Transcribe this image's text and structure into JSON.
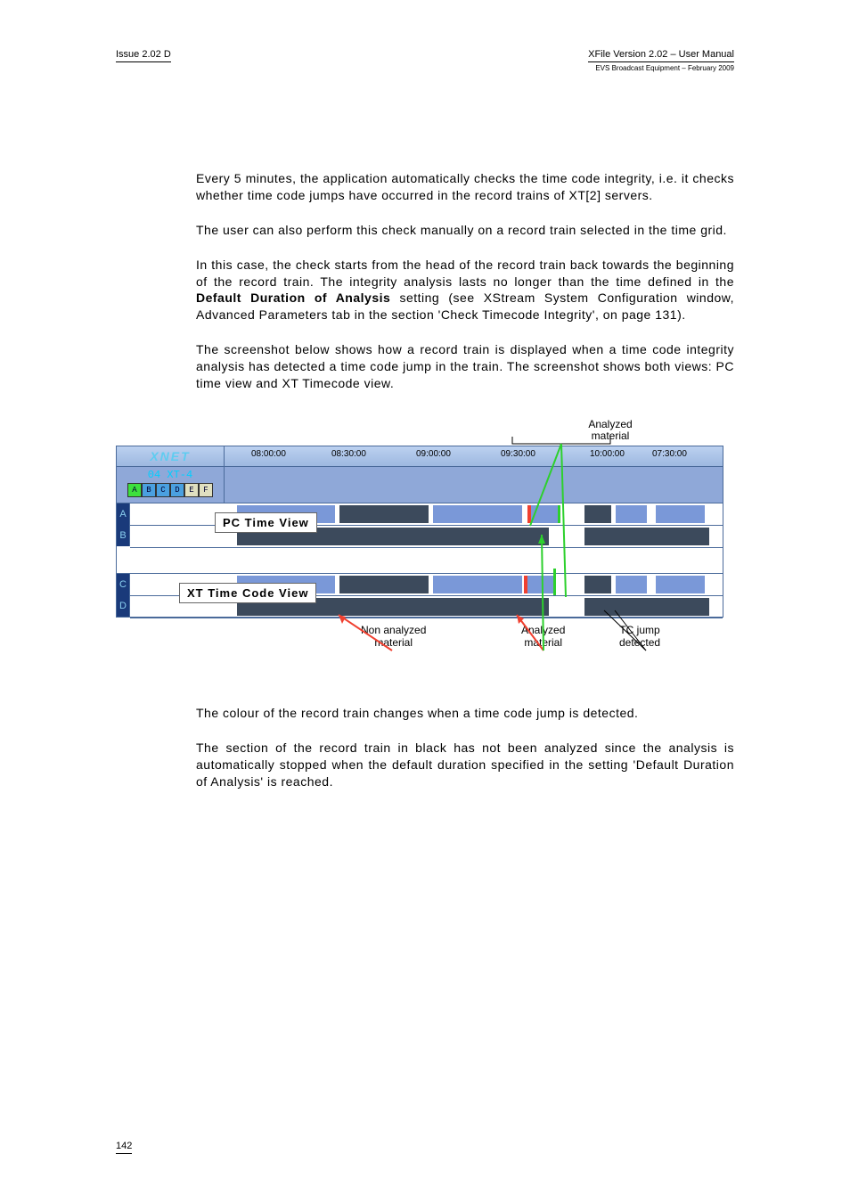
{
  "header": {
    "left": "Issue 2.02 D",
    "right_line1": "XFile Version 2.02 – User Manual",
    "right_line2": "EVS Broadcast Equipment – February 2009"
  },
  "paragraphs": {
    "p1": "Every 5 minutes, the application automatically checks the time code integrity, i.e. it checks whether time code jumps have occurred in the record trains of XT[2] servers.",
    "p2": "The user can also perform this check manually on a record train selected in the time grid.",
    "p3a": "In this case, the check starts from the head of the record train back towards the beginning of the record train. The integrity analysis lasts no longer than the time defined in the ",
    "p3b": "Default Duration of Analysis",
    "p3c": " setting (see XStream System Configuration window, Advanced Parameters tab in the section 'Check Timecode Integrity', on page 131).",
    "p4": "The screenshot below shows how a record train is displayed when a time code integrity analysis has detected a time code jump in the train. The screenshot shows both views: PC time view and XT Timecode view.",
    "p5": "The colour of the record train changes when a time code jump is detected.",
    "p6": "The section of the record train in black has not been analyzed since the analysis is automatically stopped when the default duration specified in the setting 'Default Duration of Analysis' is reached."
  },
  "diagram": {
    "top_callout": "Analyzed material",
    "xnet": "XNET",
    "ticks": [
      "08:00:00",
      "08:30:00",
      "09:00:00",
      "09:30:00",
      "10:00:00",
      "07:30:00"
    ],
    "server": "04 XT-4",
    "letters": [
      "A",
      "B",
      "C",
      "D",
      "E",
      "F"
    ],
    "row_letters_top": [
      "A",
      "B"
    ],
    "row_letters_bottom": [
      "C",
      "D"
    ],
    "pc_view_label": "PC Time View",
    "xt_view_label": "XT Time Code View",
    "callout_non": "Non analyzed material",
    "callout_ana": "Analyzed material",
    "callout_tc": "TC jump detected"
  },
  "footer": {
    "page": "142"
  }
}
